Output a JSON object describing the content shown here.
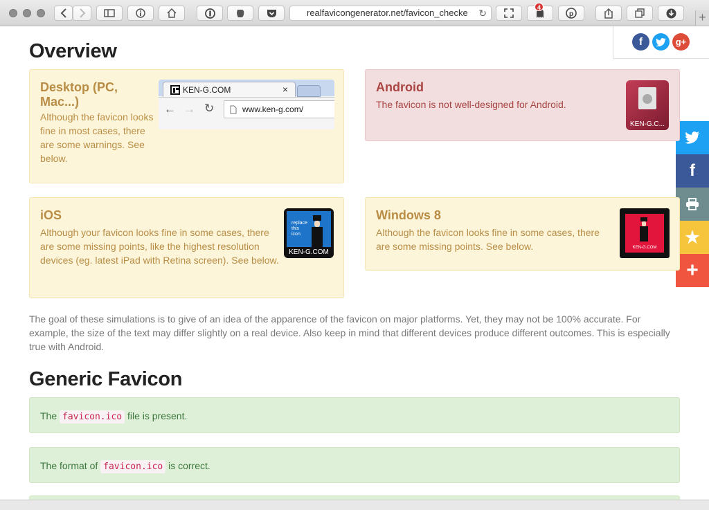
{
  "browser": {
    "url": "realfavicongenerator.net/favicon_checke",
    "ghostery_count": "4"
  },
  "overview": {
    "heading": "Overview",
    "desktop": {
      "title": "Desktop (PC, Mac...)",
      "text": "Although the favicon looks fine in most cases, there are some warnings. See below.",
      "tab_title": "KEN-G.COM",
      "address": "www.ken-g.com/"
    },
    "android": {
      "title": "Android",
      "text": "The favicon is not well-designed for Android.",
      "icon_caption": "KEN-G.C..."
    },
    "ios": {
      "title": "iOS",
      "text": "Although your favicon looks fine in some cases, there are some missing points, like the highest resolution devices (eg. latest iPad with Retina screen). See below.",
      "icon_text": "replace this icon",
      "icon_caption": "KEN-G.COM"
    },
    "windows": {
      "title": "Windows 8",
      "text": "Although the favicon looks fine in some cases, there are some missing points. See below.",
      "tile_caption": "KEN-G.COM"
    },
    "note": "The goal of these simulations is to give of an idea of the apparence of the favicon on major platforms. Yet, they may not be 100% accurate. For example, the size of the text may differ slightly on a real device. Also keep in mind that different devices produce different outcomes. This is especially true with Android."
  },
  "generic": {
    "heading": "Generic Favicon",
    "checks": [
      {
        "before": "The",
        "code": "favicon.ico",
        "after": "file is present."
      },
      {
        "before": "The format of",
        "code": "favicon.ico",
        "after": "is correct."
      }
    ]
  },
  "colors": {
    "twitter": "#1da1f2",
    "facebook": "#3b5998",
    "print": "#6f8c8f",
    "star": "#f7c53c",
    "plus": "#f0553f",
    "googleplus": "#dd4b39"
  },
  "icons": [
    "back-icon",
    "forward-icon",
    "sidebar-icon",
    "info-icon",
    "home-icon",
    "onepassword-icon",
    "evernote-icon",
    "pocket-icon",
    "reload-icon",
    "fullscreen-icon",
    "ghostery-icon",
    "pinterest-icon",
    "share-icon",
    "tabs-icon",
    "download-icon",
    "twitter-icon",
    "facebook-icon",
    "print-icon",
    "star-icon",
    "plus-icon",
    "googleplus-icon"
  ]
}
